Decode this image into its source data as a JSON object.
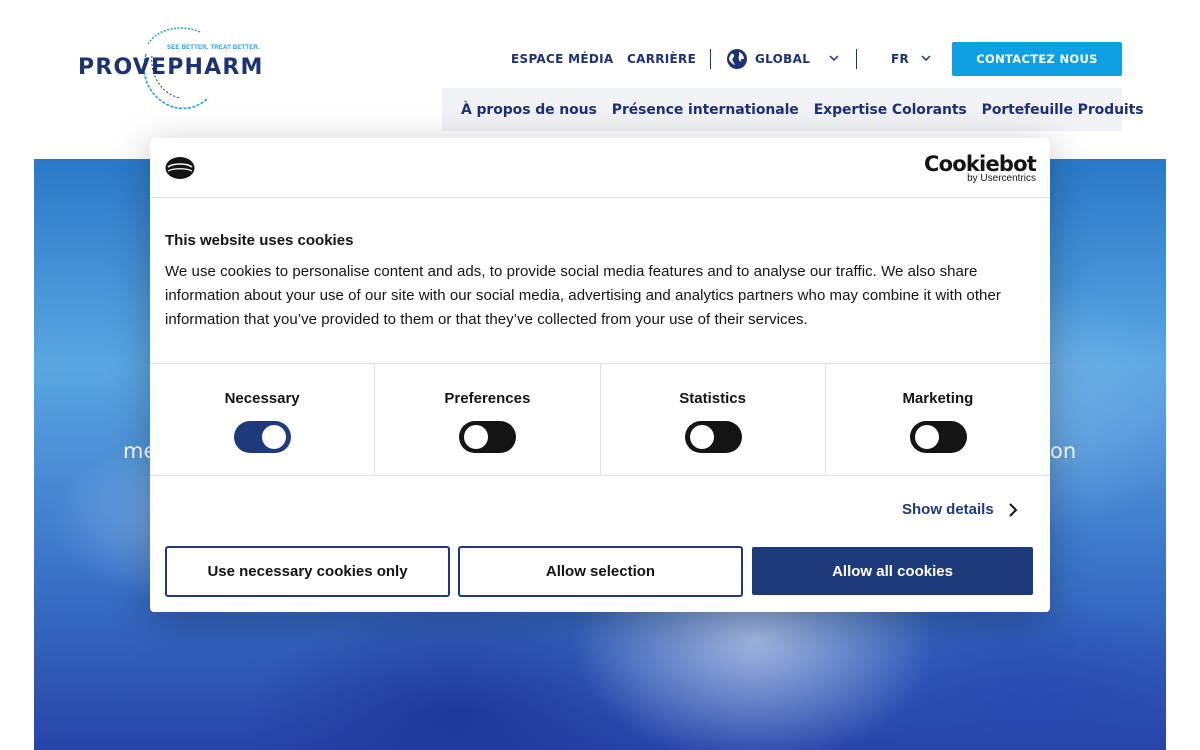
{
  "header": {
    "logo": {
      "word": "PROVEPHARM",
      "tagline": "SEE BETTER. TREAT BETTER."
    },
    "top_links": {
      "media": "ESPACE MÉDIA",
      "career": "CARRIÈRE",
      "region": "GLOBAL",
      "language": "FR"
    },
    "contact_button": "CONTACTEZ NOUS",
    "main_nav": [
      "À propos de nous",
      "Présence internationale",
      "Expertise Colorants",
      "Portefeuille Produits"
    ],
    "colors": {
      "navy": "#1c3272",
      "accent": "#0fa0e4"
    }
  },
  "hero": {
    "text_left_fragment": "me",
    "text_right_fragment": "on"
  },
  "cookie_banner": {
    "brand": {
      "name": "Cookiebot",
      "sub": "by Usercentrics"
    },
    "title": "This website uses cookies",
    "body": "We use cookies to personalise content and ads, to provide social media features and to analyse our traffic. We also share information about your use of our site with our social media, advertising and analytics partners who may combine it with other information that you’ve provided to them or that they’ve collected from your use of their services.",
    "categories": [
      {
        "label": "Necessary",
        "enabled": true
      },
      {
        "label": "Preferences",
        "enabled": false
      },
      {
        "label": "Statistics",
        "enabled": false
      },
      {
        "label": "Marketing",
        "enabled": false
      }
    ],
    "show_details": "Show details",
    "buttons": {
      "necessary_only": "Use necessary cookies only",
      "allow_selection": "Allow selection",
      "allow_all": "Allow all cookies"
    },
    "colors": {
      "primary": "#1f3a7a"
    }
  }
}
